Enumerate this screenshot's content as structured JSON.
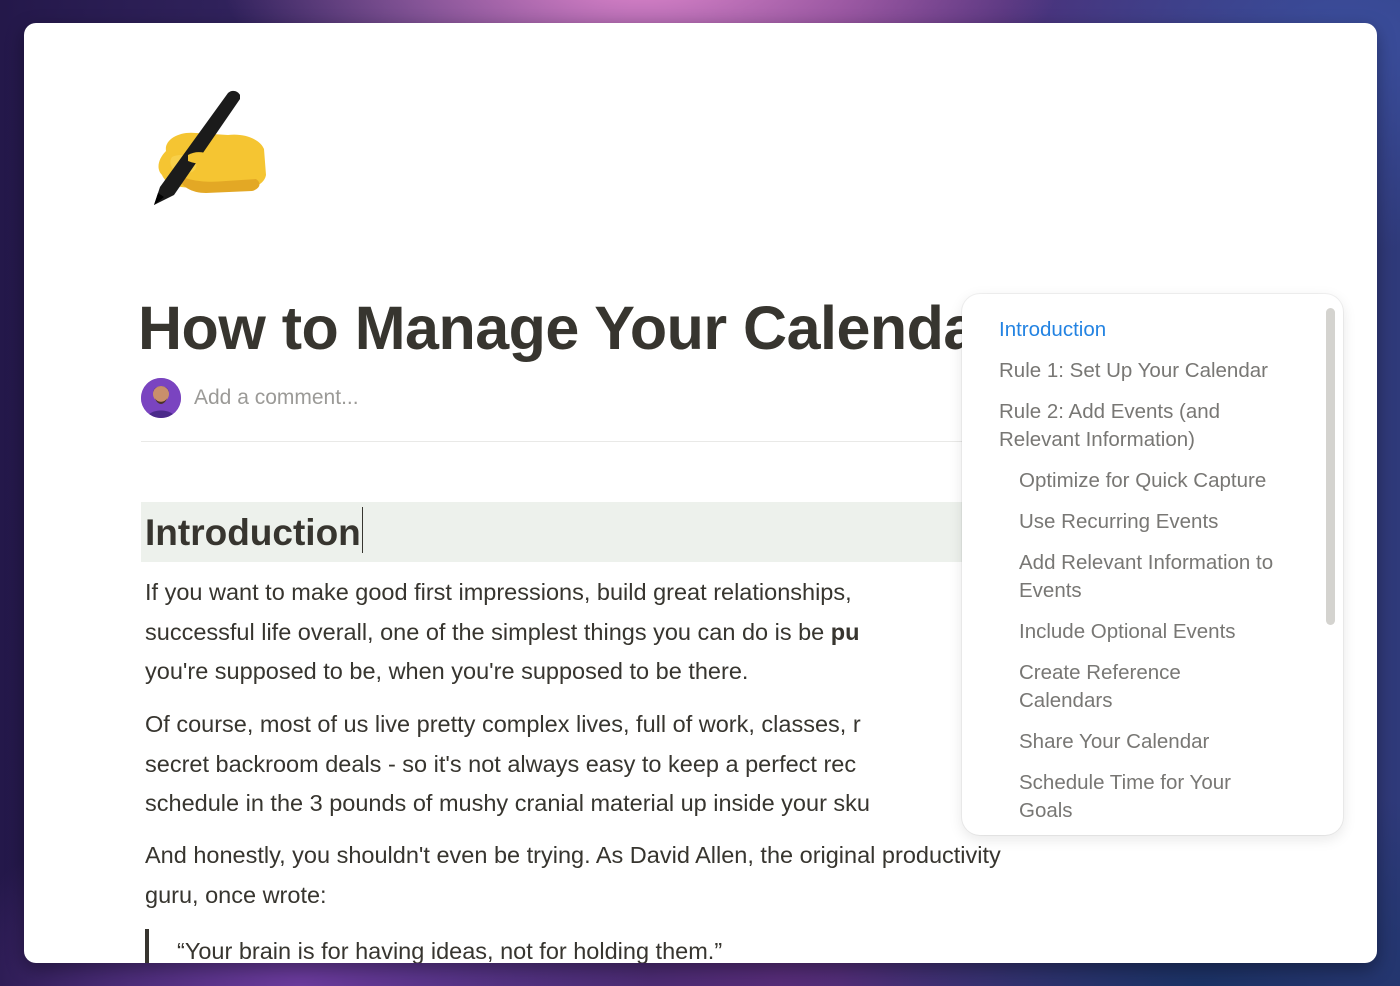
{
  "page": {
    "icon": "writing-hand-emoji",
    "title": "How to Manage Your Calendar",
    "comment_placeholder": "Add a comment..."
  },
  "content": {
    "heading": "Introduction",
    "paragraphs": [
      {
        "lines": [
          "If you want to make good first impressions, build great relationships,",
          "successful life overall, one of the simplest things you can do is be ",
          "you're supposed to be, when you're supposed to be there."
        ],
        "bold_fragment": "pu"
      },
      {
        "lines": [
          "Of course, most of us live pretty complex lives, full of work, classes, r",
          "secret backroom deals - so it's not always easy to keep a perfect rec",
          "schedule in the 3 pounds of mushy cranial material up inside your sku"
        ]
      },
      {
        "lines": [
          "And honestly, you shouldn't even be trying. As David Allen, the original productivity",
          "guru, once wrote:"
        ]
      }
    ],
    "quote": "“Your brain is for having ideas, not for holding them.”"
  },
  "toc": {
    "active_color": "#2383e2",
    "items": [
      {
        "label": "Introduction",
        "level": 1,
        "active": true
      },
      {
        "label": "Rule 1: Set Up Your Calendar",
        "level": 1
      },
      {
        "label": "Rule 2: Add Events (and Relevant Information)",
        "level": 1
      },
      {
        "label": "Optimize for Quick Capture",
        "level": 2
      },
      {
        "label": "Use Recurring Events",
        "level": 2
      },
      {
        "label": "Add Relevant Information to Events",
        "level": 2
      },
      {
        "label": "Include Optional Events",
        "level": 2
      },
      {
        "label": "Create Reference Calendars",
        "level": 2
      },
      {
        "label": "Share Your Calendar",
        "level": 2
      },
      {
        "label": "Schedule Time for Your Goals",
        "level": 2
      }
    ]
  }
}
